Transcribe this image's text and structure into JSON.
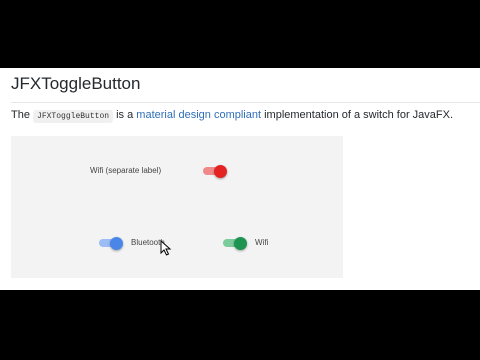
{
  "page": {
    "title": "JFXToggleButton",
    "desc_prefix": "The",
    "desc_code": "JFXToggleButton",
    "desc_is_a": "is a",
    "desc_link": "material design compliant",
    "desc_suffix": "implementation of a switch for JavaFX."
  },
  "demo": {
    "wifi_separate_label": "Wifi (separate label)",
    "bluetooth_label": "Bluetooth",
    "wifi_label": "Wifi",
    "toggles": [
      {
        "name": "wifi-separate",
        "state": "on",
        "track_color": "#f08a8a",
        "thumb_color": "#e52222"
      },
      {
        "name": "bluetooth",
        "state": "on",
        "track_color": "#9bbcf5",
        "thumb_color": "#4a86e8"
      },
      {
        "name": "wifi",
        "state": "on",
        "track_color": "#7ccb9b",
        "thumb_color": "#1e9450"
      }
    ]
  }
}
